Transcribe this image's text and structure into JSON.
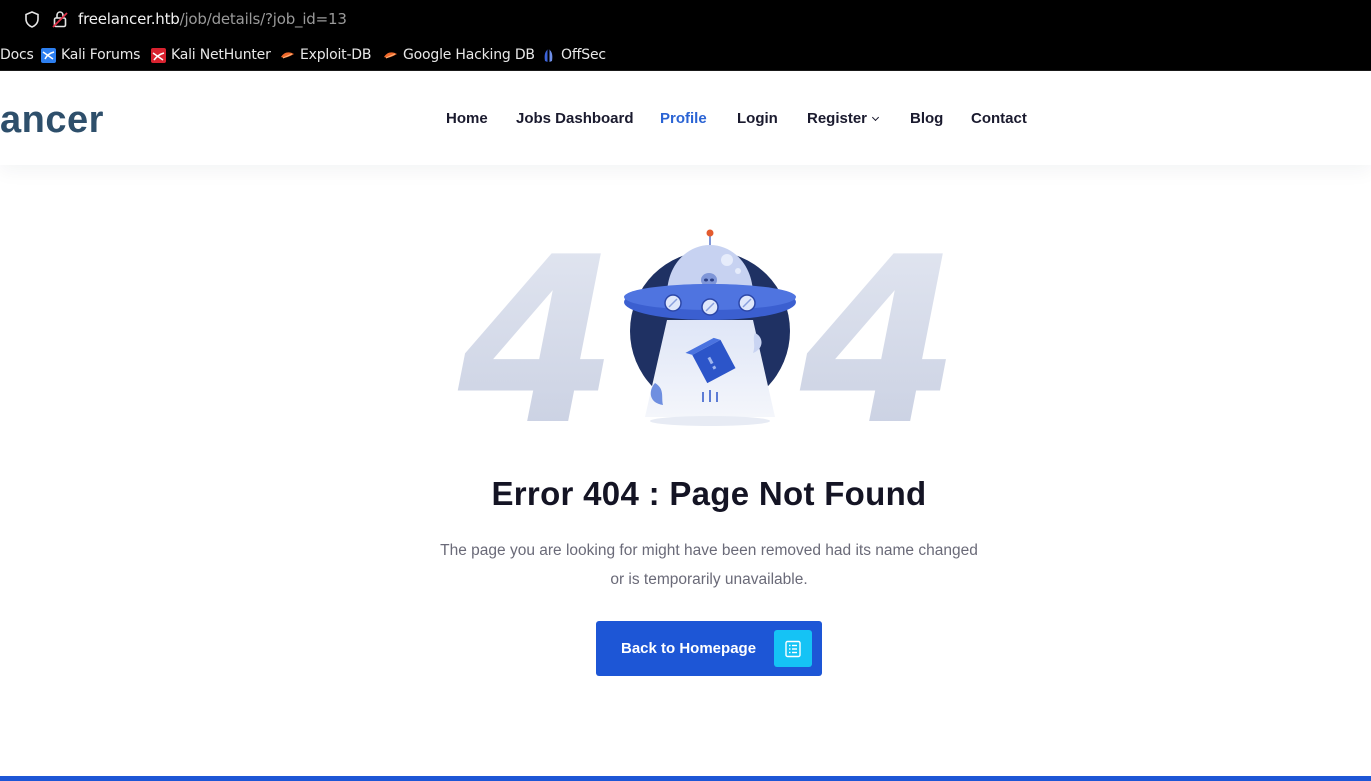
{
  "browser": {
    "url_host": "freelancer.htb",
    "url_path": "/job/details/?job_id=13",
    "bookmarks": [
      {
        "label": "Docs",
        "icon": "kali-docs-icon"
      },
      {
        "label": "Kali Forums",
        "icon": "kali-forums-icon"
      },
      {
        "label": "Kali NetHunter",
        "icon": "kali-nethunter-icon"
      },
      {
        "label": "Exploit-DB",
        "icon": "exploit-db-icon"
      },
      {
        "label": "Google Hacking DB",
        "icon": "ghdb-icon"
      },
      {
        "label": "OffSec",
        "icon": "offsec-icon"
      }
    ]
  },
  "site": {
    "logo_text": "ancer",
    "nav": [
      {
        "label": "Home"
      },
      {
        "label": "Jobs Dashboard"
      },
      {
        "label": "Profile",
        "active": true
      },
      {
        "label": "Login"
      },
      {
        "label": "Register",
        "dropdown": true
      },
      {
        "label": "Blog"
      },
      {
        "label": "Contact"
      }
    ]
  },
  "error": {
    "digit_left": "4",
    "digit_right": "4",
    "title": "Error 404 : Page Not Found",
    "description_line1": "The page you are looking for might have been removed had its name changed",
    "description_line2": "or is temporarily unavailable.",
    "button_label": "Back to Homepage",
    "button_icon": "list-document-icon"
  },
  "colors": {
    "accent": "#1d56d6",
    "active_nav": "#2a63d4",
    "button_icon_bg": "#15c3f5",
    "logo": "#2e4f6b",
    "digits": "#cfd5e6"
  }
}
